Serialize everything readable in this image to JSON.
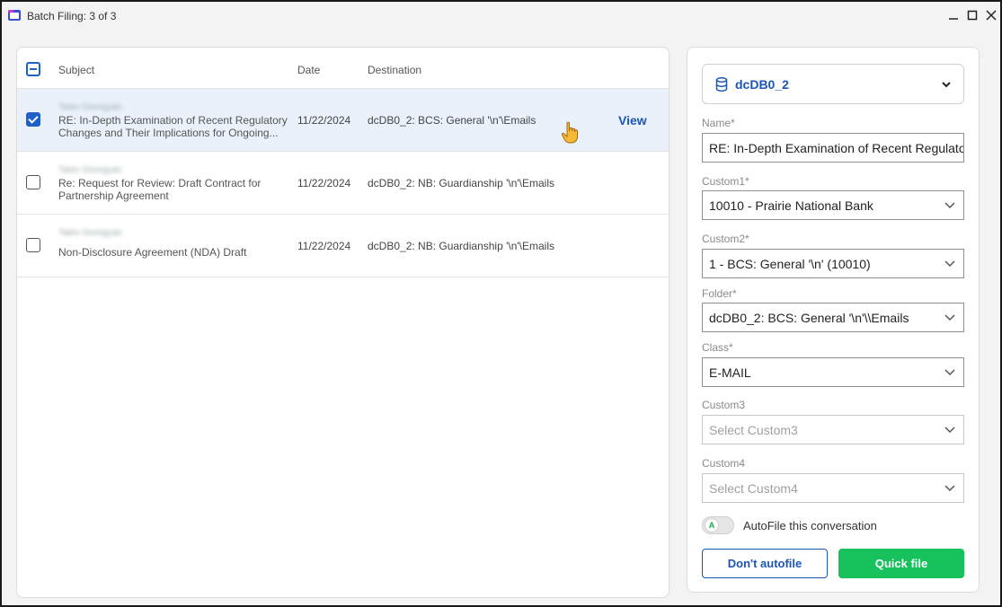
{
  "window": {
    "title": "Batch Filing: 3 of 3",
    "controls": {
      "minimize": "_",
      "maximize": "☐",
      "close": "✕"
    }
  },
  "table": {
    "headers": {
      "subject": "Subject",
      "date": "Date",
      "destination": "Destination"
    },
    "rows": [
      {
        "sender": "Tatev Georgyan",
        "subject": "RE: In-Depth Examination of Recent Regulatory Changes and Their Implications for Ongoing...",
        "date": "11/22/2024",
        "destination": "dcDB0_2: BCS: General '\\n'\\Emails",
        "checked": true,
        "action": "View"
      },
      {
        "sender": "Tatev Georgyan",
        "subject": "Re: Request for Review: Draft Contract for Partnership Agreement",
        "date": "11/22/2024",
        "destination": "dcDB0_2: NB: Guardianship '\\n'\\Emails",
        "checked": false
      },
      {
        "sender": "Tatev Georgyan",
        "subject": "Non-Disclosure Agreement (NDA) Draft",
        "date": "11/22/2024",
        "destination": "dcDB0_2: NB: Guardianship '\\n'\\Emails",
        "checked": false
      }
    ]
  },
  "form": {
    "database": "dcDB0_2",
    "name": {
      "label": "Name*",
      "value": "RE: In-Depth Examination of Recent Regulatory Changes"
    },
    "custom1": {
      "label": "Custom1*",
      "value": "10010 - Prairie National Bank"
    },
    "custom2": {
      "label": "Custom2*",
      "value": "1 - BCS: General '\\n' (10010)"
    },
    "folder": {
      "label": "Folder*",
      "value": "dcDB0_2: BCS: General '\\n'\\\\Emails"
    },
    "class": {
      "label": "Class*",
      "value": "E-MAIL"
    },
    "custom3": {
      "label": "Custom3",
      "placeholder": "Select Custom3"
    },
    "custom4": {
      "label": "Custom4",
      "placeholder": "Select Custom4"
    },
    "autofile": {
      "knob": "A",
      "label": "AutoFile this conversation",
      "enabled": false
    },
    "buttons": {
      "dont_autofile": "Don't autofile",
      "quick_file": "Quick file"
    }
  },
  "colors": {
    "accent_blue": "#1a56b8",
    "checkbox_blue": "#1e62c9",
    "selected_row": "#eaf1fb",
    "primary_green": "#17c15c"
  }
}
